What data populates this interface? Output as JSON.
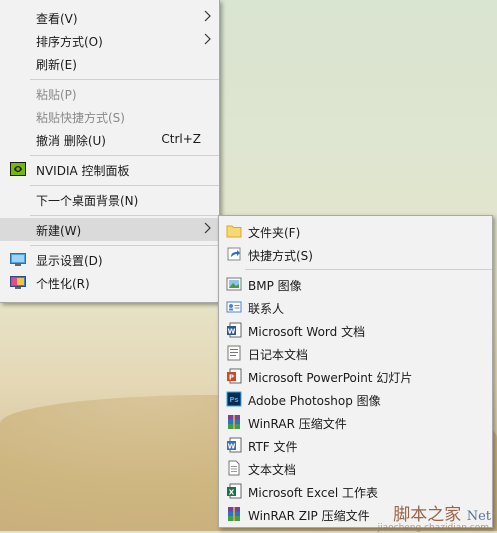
{
  "context_menu": {
    "items": [
      {
        "label": "查看(V)"
      },
      {
        "label": "排序方式(O)"
      },
      {
        "label": "刷新(E)"
      },
      {
        "label": "粘贴(P)"
      },
      {
        "label": "粘贴快捷方式(S)"
      },
      {
        "label": "撤消 删除(U)",
        "shortcut": "Ctrl+Z"
      },
      {
        "label": "NVIDIA 控制面板"
      },
      {
        "label": "下一个桌面背景(N)"
      },
      {
        "label": "新建(W)"
      },
      {
        "label": "显示设置(D)"
      },
      {
        "label": "个性化(R)"
      }
    ]
  },
  "new_submenu": {
    "items": [
      {
        "label": "文件夹(F)",
        "icon": "folder-icon"
      },
      {
        "label": "快捷方式(S)",
        "icon": "shortcut-icon"
      },
      {
        "label": "BMP 图像",
        "icon": "bmp-image-icon"
      },
      {
        "label": "联系人",
        "icon": "contact-icon"
      },
      {
        "label": "Microsoft Word 文档",
        "icon": "word-document-icon"
      },
      {
        "label": "日记本文档",
        "icon": "journal-document-icon"
      },
      {
        "label": "Microsoft PowerPoint 幻灯片",
        "icon": "powerpoint-icon"
      },
      {
        "label": "Adobe Photoshop 图像",
        "icon": "photoshop-icon"
      },
      {
        "label": "WinRAR 压缩文件",
        "icon": "winrar-icon"
      },
      {
        "label": "RTF 文件",
        "icon": "rtf-document-icon"
      },
      {
        "label": "文本文档",
        "icon": "text-document-icon"
      },
      {
        "label": "Microsoft Excel 工作表",
        "icon": "excel-icon"
      },
      {
        "label": "WinRAR ZIP 压缩文件",
        "icon": "winrar-zip-icon"
      }
    ]
  },
  "watermark": {
    "text": "脚本之家",
    "sub": "jiaocheng.chazidian.com",
    "right": "Net"
  },
  "colors": {
    "menu_bg": "#f2f2f2",
    "highlight": "#dadada",
    "disabled_text": "#8a8a8a"
  }
}
